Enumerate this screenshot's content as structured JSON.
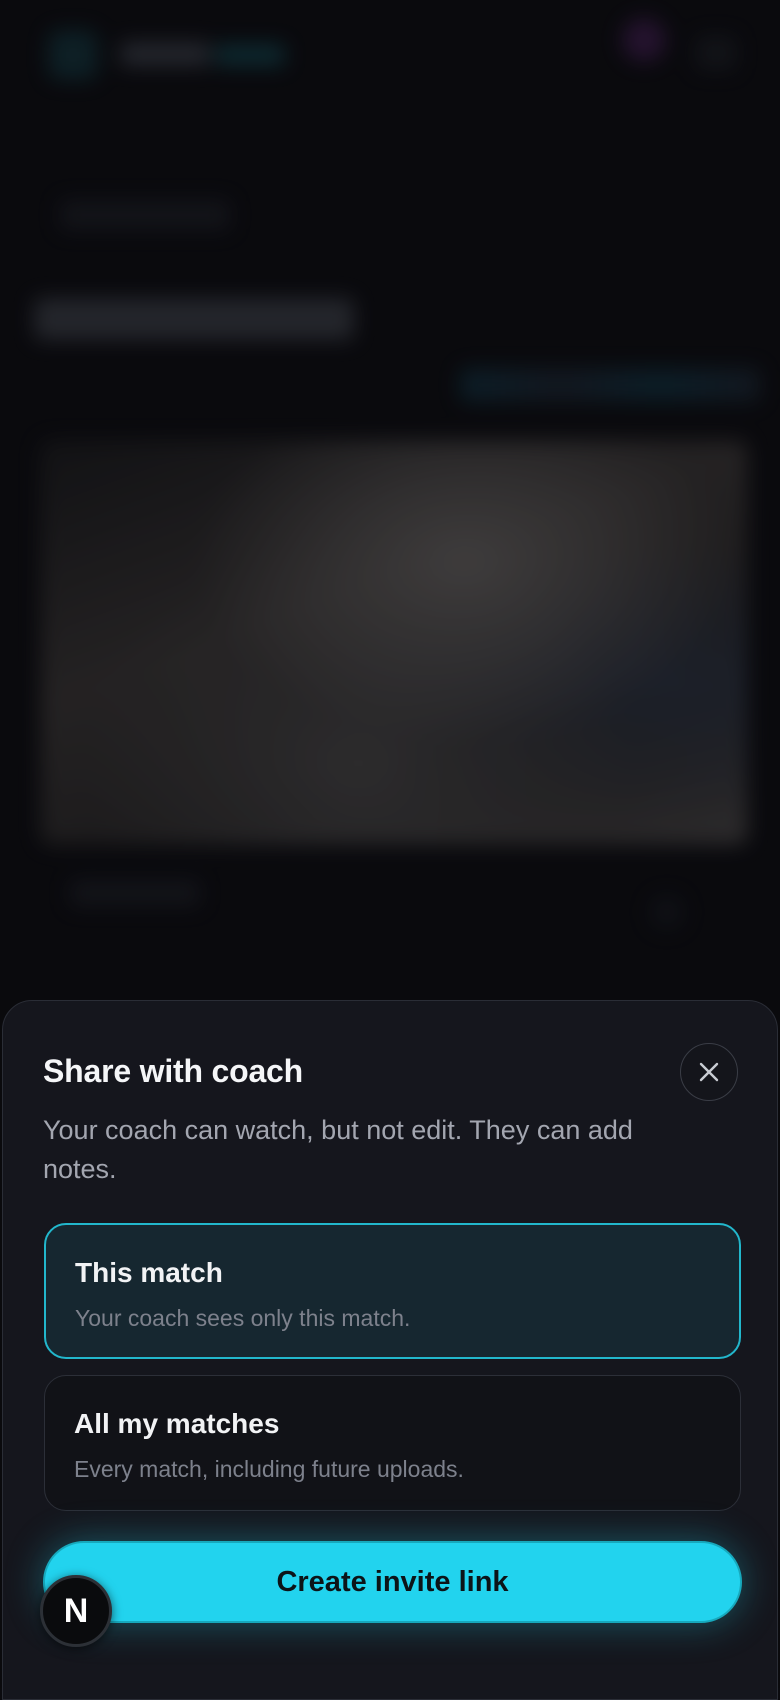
{
  "sheet": {
    "title": "Share with coach",
    "description": "Your coach can watch, but not edit. They can add notes.",
    "close_icon": "close-icon",
    "options": [
      {
        "title": "This match",
        "subtitle": "Your coach sees only this match.",
        "selected": true
      },
      {
        "title": "All my matches",
        "subtitle": "Every match, including future uploads.",
        "selected": false
      }
    ],
    "cta_label": "Create invite link"
  },
  "badge": {
    "letter": "N"
  },
  "colors": {
    "accent": "#22d3ee",
    "sheet_background": "#15161d",
    "selected_border": "#22b7cc",
    "page_background": "#0b0b0f"
  }
}
